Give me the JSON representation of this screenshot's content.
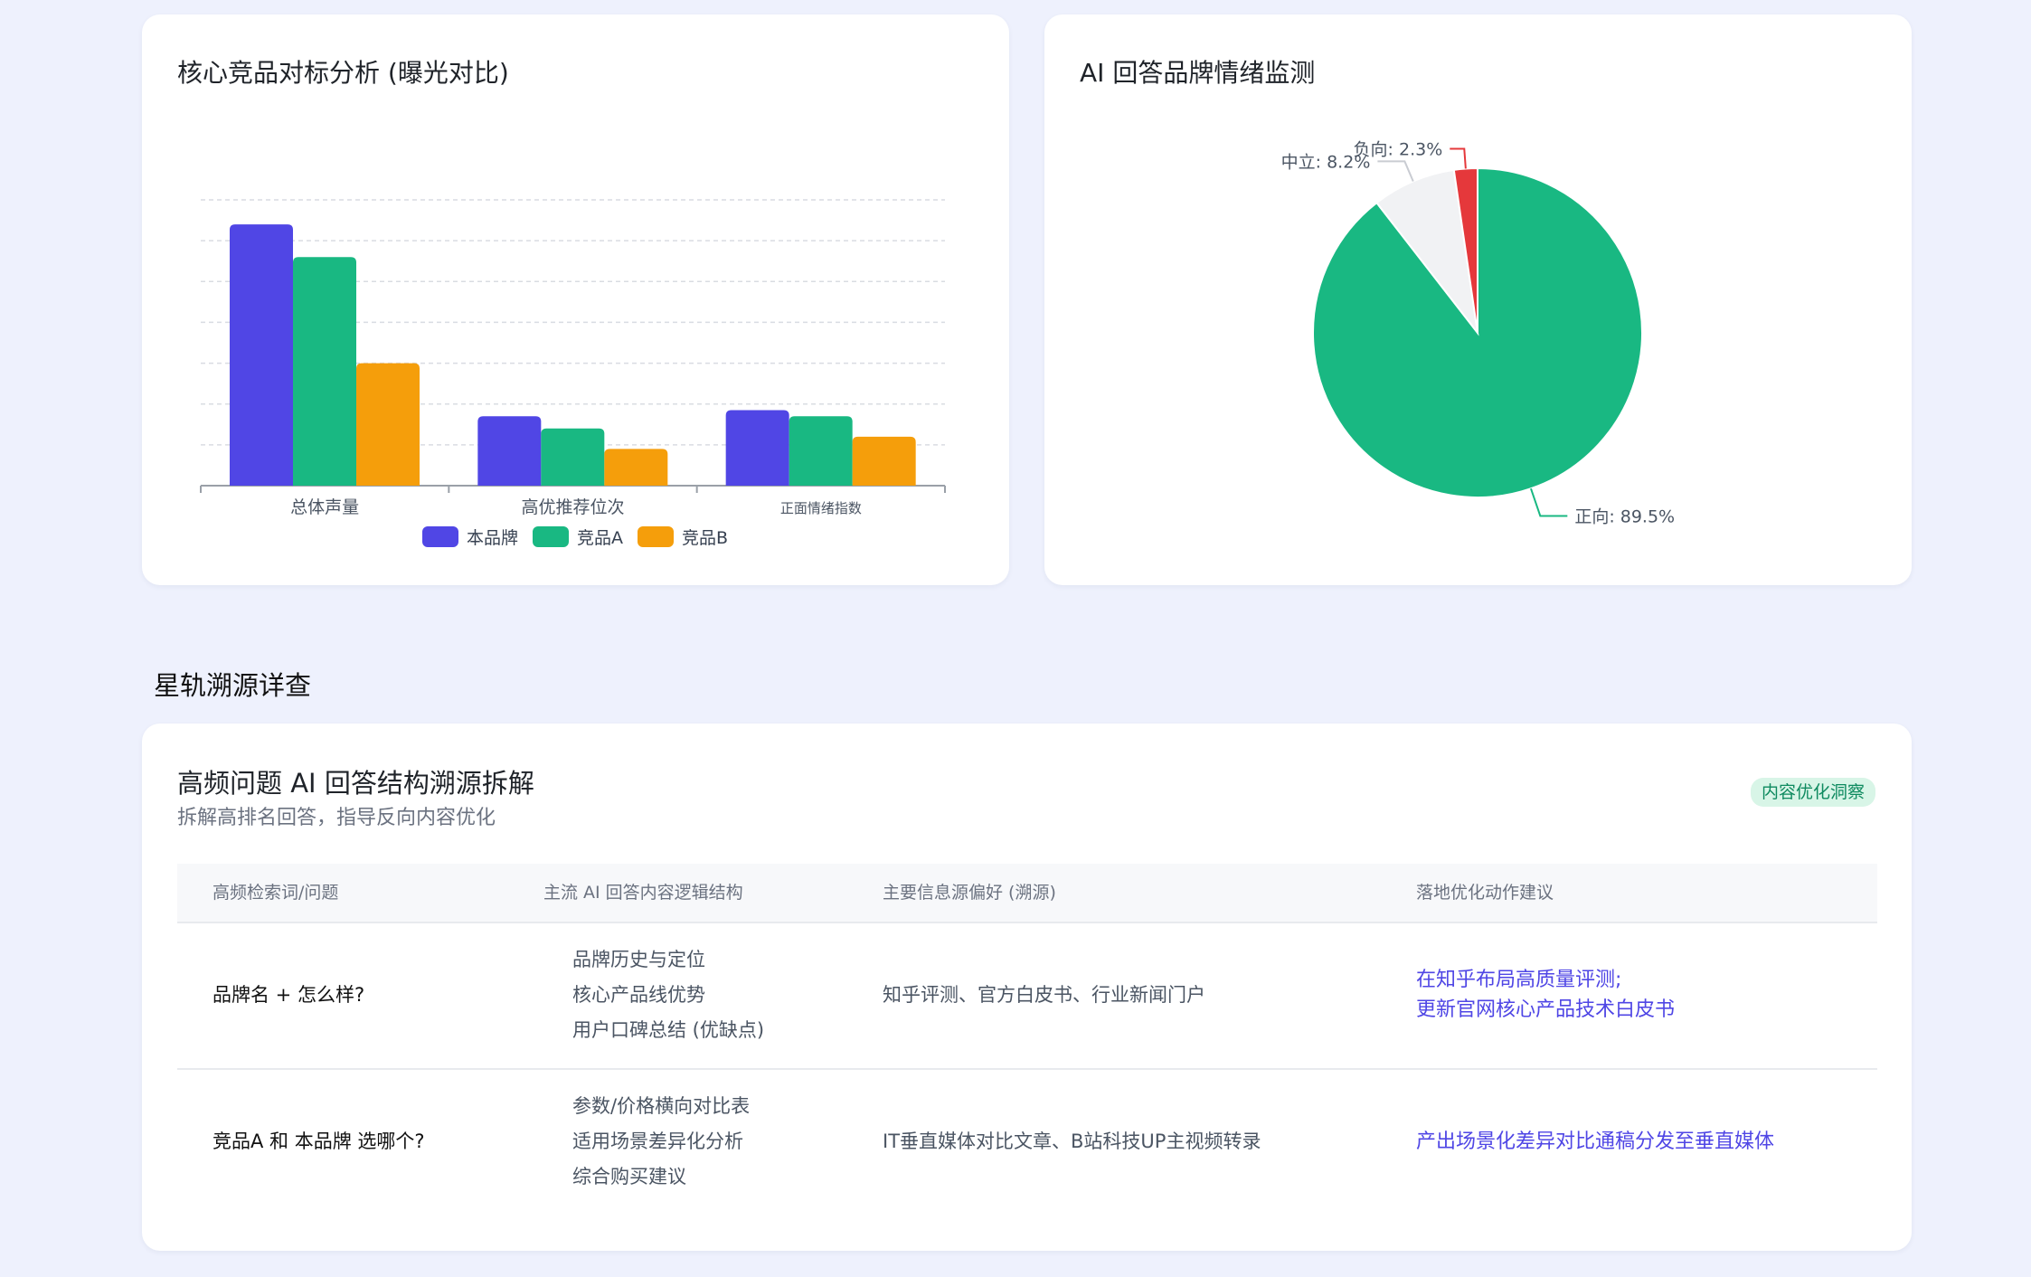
{
  "colors": {
    "brand": "#5046e5",
    "competitor_a": "#19b882",
    "competitor_b": "#f59e0b",
    "positive": "#19b882",
    "neutral": "#f1f2f4",
    "negative": "#e5383b",
    "action": "#4f46e5",
    "badge_bg": "#d8f5e7",
    "badge_text": "#0e8a5f"
  },
  "bar_card": {
    "title": "核心竞品对标分析 (曝光对比)"
  },
  "pie_card": {
    "title": "AI 回答品牌情绪监测"
  },
  "chart_data": [
    {
      "type": "bar",
      "title": "核心竞品对标分析 (曝光对比)",
      "categories": [
        "总体声量",
        "高优推荐位次",
        "正面情绪指数"
      ],
      "series": [
        {
          "name": "本品牌",
          "values": [
            64,
            17,
            18.5
          ]
        },
        {
          "name": "竞品A",
          "values": [
            56,
            14,
            17
          ]
        },
        {
          "name": "竞品B",
          "values": [
            30,
            9,
            12
          ]
        }
      ],
      "ylim": [
        0,
        70
      ],
      "grid": true,
      "legend": "bottom"
    },
    {
      "type": "pie",
      "title": "AI 回答品牌情绪监测",
      "slices": [
        {
          "label": "正向",
          "value": 89.5,
          "text": "正向: 89.5%"
        },
        {
          "label": "中立",
          "value": 8.2,
          "text": "中立: 8.2%"
        },
        {
          "label": "负向",
          "value": 2.3,
          "text": "负向: 2.3%"
        }
      ]
    }
  ],
  "section": {
    "title": "星轨溯源详查"
  },
  "table_card": {
    "title": "高频问题 AI 回答结构溯源拆解",
    "subtitle": "拆解高排名回答，指导反向内容优化",
    "badge": "内容优化洞察",
    "headers": [
      "高频检索词/问题",
      "主流 AI 回答内容逻辑结构",
      "主要信息源偏好 (溯源)",
      "落地优化动作建议"
    ],
    "rows": [
      {
        "question": "品牌名 + 怎么样?",
        "structure": [
          "品牌历史与定位",
          "核心产品线优势",
          "用户口碑总结 (优缺点)"
        ],
        "sources": "知乎评测、官方白皮书、行业新闻门户",
        "actions": [
          "在知乎布局高质量评测;",
          "更新官网核心产品技术白皮书"
        ]
      },
      {
        "question": "竞品A 和 本品牌 选哪个?",
        "structure": [
          "参数/价格横向对比表",
          "适用场景差异化分析",
          "综合购买建议"
        ],
        "sources": "IT垂直媒体对比文章、B站科技UP主视频转录",
        "actions": [
          "产出场景化差异对比通稿分发至垂直媒体"
        ]
      }
    ]
  }
}
